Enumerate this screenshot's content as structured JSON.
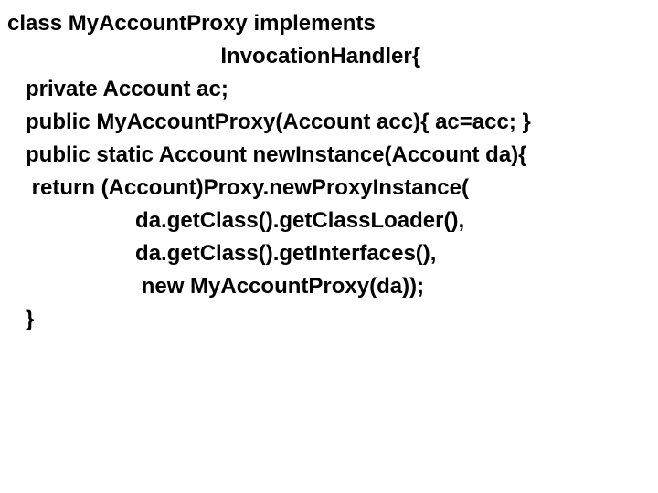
{
  "code": {
    "line1": "class MyAccountProxy implements",
    "line2": "                                   InvocationHandler{",
    "line3": "   private Account ac;",
    "line4": "   public MyAccountProxy(Account acc){ ac=acc; }",
    "line5": "   public static Account newInstance(Account da){",
    "line6": "    return (Account)Proxy.newProxyInstance(",
    "line7": "                     da.getClass().getClassLoader(),",
    "line8": "                     da.getClass().getInterfaces(),",
    "line9": "                      new MyAccountProxy(da));",
    "line10": "   }"
  }
}
